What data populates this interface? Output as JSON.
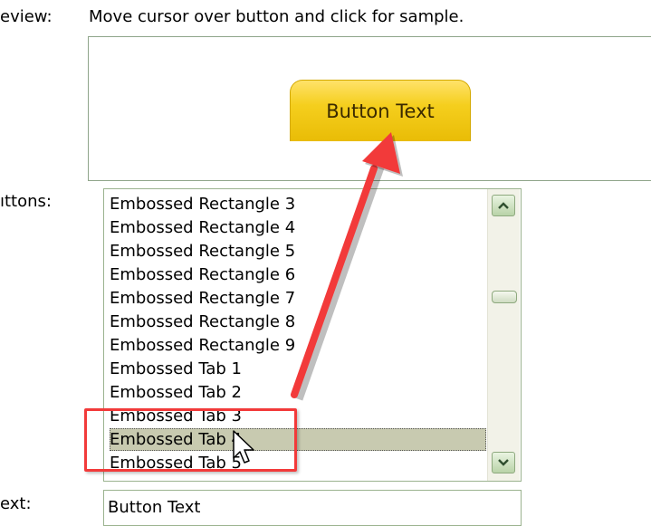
{
  "labels": {
    "preview": "eview:",
    "preview_hint": "Move cursor over button and click for sample.",
    "buttons": "ıttons:",
    "text": "ext:"
  },
  "preview": {
    "sample_button_label": "Button Text"
  },
  "listbox": {
    "items": [
      "Embossed Rectangle 3",
      "Embossed Rectangle 4",
      "Embossed Rectangle 5",
      "Embossed Rectangle 6",
      "Embossed Rectangle 7",
      "Embossed Rectangle 8",
      "Embossed Rectangle 9",
      "Embossed Tab 1",
      "Embossed Tab 2",
      "Embossed Tab 3",
      "Embossed Tab 4",
      "Embossed Tab 5"
    ],
    "selected": "Embossed Tab 4"
  },
  "text_field": {
    "value": "Button Text"
  },
  "icons": {
    "scroll_up": "chevron-up-icon",
    "scroll_down": "chevron-down-icon",
    "cursor": "mouse-pointer-icon",
    "annotation_arrow": "red-arrow-icon"
  },
  "colors": {
    "button_gold": "#f5cf1e",
    "panel_border": "#8fa58a",
    "selection": "#c8cab0",
    "annotation_red": "#f23a3a"
  }
}
